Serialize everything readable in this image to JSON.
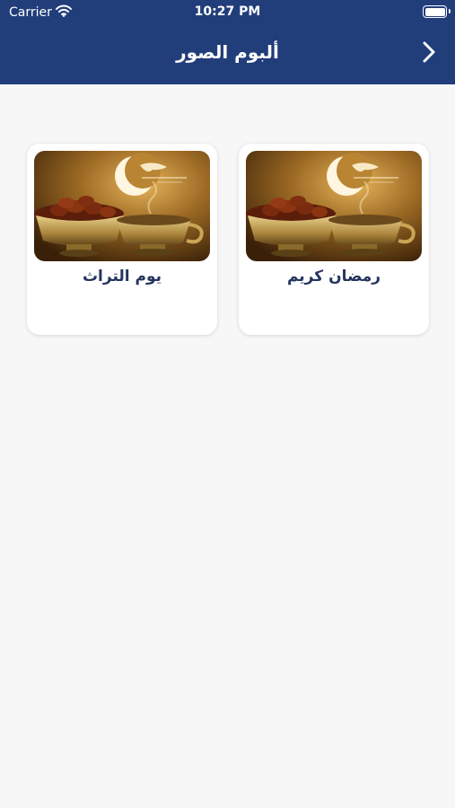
{
  "status_bar": {
    "carrier": "Carrier",
    "time": "10:27 PM",
    "icons": [
      "wifi-icon",
      "battery-icon"
    ]
  },
  "nav": {
    "title": "ألبوم الصور",
    "back_icon": "chevron-right-icon"
  },
  "albums": [
    {
      "label": "رمضان كريم",
      "image": "ramadan-kareem-photo"
    },
    {
      "label": "يوم التراث",
      "image": "ramadan-kareem-photo"
    }
  ],
  "colors": {
    "header": "#213d7a",
    "background": "#f7f7f8",
    "card": "#ffffff",
    "label": "#25345e"
  }
}
